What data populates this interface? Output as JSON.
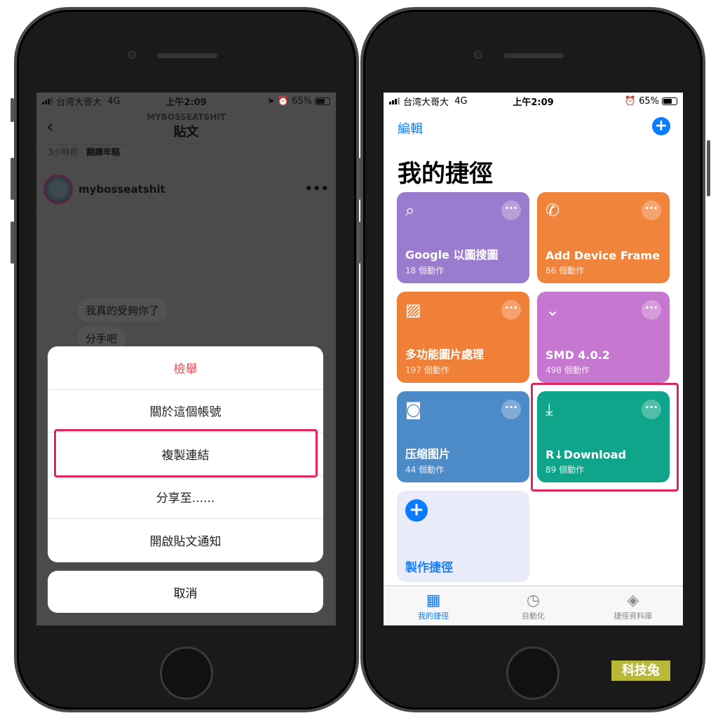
{
  "left_phone": {
    "status": {
      "carrier": "台湾大哥大",
      "network": "4G",
      "time": "上午2:09",
      "battery": "65%"
    },
    "nav": {
      "subtitle": "MYBOSSEATSHIT",
      "title": "貼文"
    },
    "meta": {
      "time_ago": "3小時前",
      "separator": " · ",
      "translate": "翻譯年糕"
    },
    "post": {
      "username": "mybosseatshit",
      "more": "•••"
    },
    "bubbles": [
      "我真的受夠你了",
      "分手吧"
    ],
    "sheet": {
      "items": [
        "檢舉",
        "關於這個帳號",
        "複製連結",
        "分享至......",
        "開啟貼文通知"
      ],
      "cancel": "取消"
    }
  },
  "right_phone": {
    "status": {
      "carrier": "台湾大哥大",
      "network": "4G",
      "time": "上午2:09",
      "battery": "65%"
    },
    "edit": "編輯",
    "add": "+",
    "title": "我的捷徑",
    "cards": [
      {
        "name": "Google 以圖搜圖",
        "count": "18 個動作",
        "icon": "search-icon",
        "color": "#9a7bcd"
      },
      {
        "name": "Add Device Frame",
        "count": "66 個動作",
        "icon": "phone-icon",
        "color": "#f0843c"
      },
      {
        "name": "多功能圖片處理",
        "count": "197 個動作",
        "icon": "photo-icon",
        "color": "#f07f38"
      },
      {
        "name": "SMD 4.0.2",
        "count": "498 個動作",
        "icon": "chevron-down-circle-icon",
        "color": "#c677cf"
      },
      {
        "name": "压缩图片",
        "count": "44 個動作",
        "icon": "camera-icon",
        "color": "#4d8bc8"
      },
      {
        "name": "R↓Download",
        "count": "89 個動作",
        "icon": "download-icon",
        "color": "#0fa58a"
      }
    ],
    "create": "製作捷徑",
    "tabs": [
      "我的捷徑",
      "自動化",
      "捷徑資料庫"
    ],
    "accent": "#0a7cff"
  },
  "watermark": "科技兔"
}
